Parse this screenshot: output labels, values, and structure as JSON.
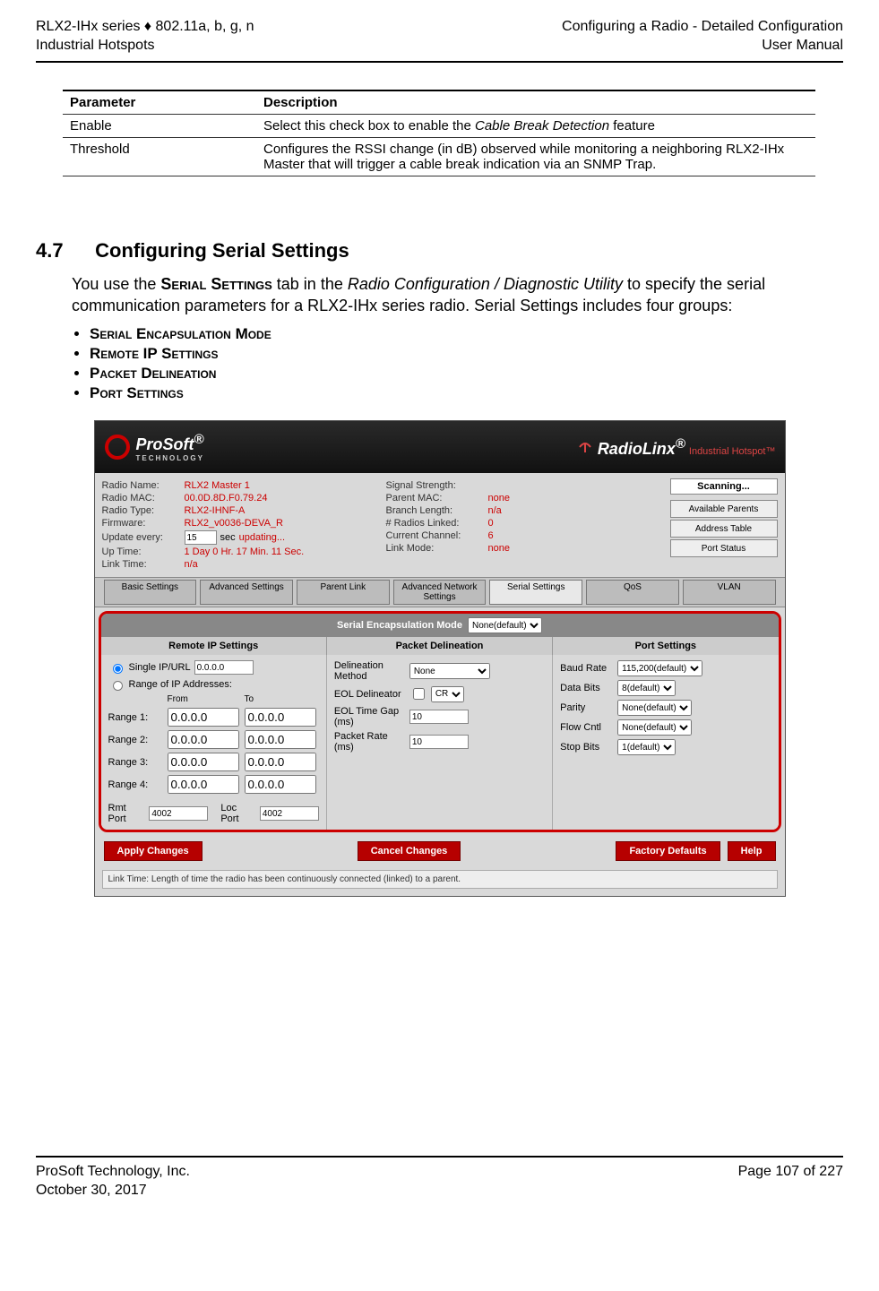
{
  "header": {
    "left1": "RLX2-IHx series ♦ 802.11a, b, g, n",
    "left2": "Industrial Hotspots",
    "right1": "Configuring a Radio - Detailed Configuration",
    "right2": "User Manual"
  },
  "param_table": {
    "headers": [
      "Parameter",
      "Description"
    ],
    "rows": [
      [
        "Enable",
        "Select this check box to enable the Cable Break Detection feature"
      ],
      [
        "Threshold",
        "Configures the RSSI change (in dB) observed while monitoring a neighboring RLX2-IHx Master that will trigger a cable break indication via an SNMP Trap."
      ]
    ],
    "italic_phrase": "Cable Break Detection"
  },
  "section": {
    "number": "4.7",
    "title": "Configuring Serial Settings",
    "intro_pre": "You use the ",
    "intro_sc1": "Serial Settings",
    "intro_mid": " tab in the ",
    "intro_italic": "Radio Configuration / Diagnostic Utility",
    "intro_post": " to specify the serial communication parameters for a RLX2-IHx series radio. Serial Settings includes four groups:",
    "bullets": [
      "Serial Encapsulation Mode",
      "Remote IP Settings",
      "Packet Delineation",
      "Port Settings"
    ]
  },
  "app": {
    "prosoft": {
      "name": "ProSoft",
      "sub": "TECHNOLOGY"
    },
    "radiolinx": {
      "name": "RadioLinx",
      "tag": "Industrial Hotspot™"
    },
    "info_left": [
      {
        "label": "Radio Name:",
        "value": "RLX2 Master 1"
      },
      {
        "label": "Radio MAC:",
        "value": "00.0D.8D.F0.79.24"
      },
      {
        "label": "Radio Type:",
        "value": "RLX2-IHNF-A"
      },
      {
        "label": "Firmware:",
        "value": "RLX2_v0036-DEVA_R"
      }
    ],
    "update_every": {
      "label": "Update every:",
      "value": "15",
      "unit": "sec",
      "status": "updating..."
    },
    "info_left2": [
      {
        "label": "Up Time:",
        "value": "1 Day 0 Hr. 17 Min. 11 Sec."
      },
      {
        "label": "Link Time:",
        "value": "n/a"
      }
    ],
    "info_mid": [
      {
        "label": "Signal Strength:"
      },
      {
        "label": "Parent MAC:",
        "value": "none"
      },
      {
        "label": "Branch Length:",
        "value": "n/a"
      },
      {
        "label": "# Radios Linked:",
        "value": "0"
      },
      {
        "label": "Current Channel:",
        "value": "6"
      },
      {
        "label": "Link Mode:",
        "value": "none"
      }
    ],
    "scanning": "Scanning...",
    "side_buttons": [
      "Available Parents",
      "Address Table",
      "Port Status"
    ],
    "tabs": [
      "Basic Settings",
      "Advanced Settings",
      "Parent Link",
      "Advanced Network Settings",
      "Serial Settings",
      "QoS",
      "VLAN"
    ],
    "enc_label": "Serial Encapsulation Mode",
    "enc_value": "None(default)",
    "col_heads": [
      "Remote IP Settings",
      "Packet Delineation",
      "Port Settings"
    ],
    "remote": {
      "single_label": "Single IP/URL",
      "single_value": "0.0.0.0",
      "range_label": "Range of IP Addresses:",
      "from": "From",
      "to": "To",
      "ranges": [
        {
          "name": "Range 1:",
          "from": "0.0.0.0",
          "to": "0.0.0.0"
        },
        {
          "name": "Range 2:",
          "from": "0.0.0.0",
          "to": "0.0.0.0"
        },
        {
          "name": "Range 3:",
          "from": "0.0.0.0",
          "to": "0.0.0.0"
        },
        {
          "name": "Range 4:",
          "from": "0.0.0.0",
          "to": "0.0.0.0"
        }
      ],
      "rmt_port_label": "Rmt Port",
      "rmt_port": "4002",
      "loc_port_label": "Loc Port",
      "loc_port": "4002"
    },
    "delineation": {
      "rows": [
        {
          "label": "Delineation Method",
          "type": "select",
          "value": "None"
        },
        {
          "label": "EOL Delineator",
          "type": "checkbox_select",
          "value": "CR"
        },
        {
          "label": "EOL Time Gap (ms)",
          "type": "text",
          "value": "10"
        },
        {
          "label": "Packet Rate (ms)",
          "type": "text",
          "value": "10"
        }
      ]
    },
    "port": {
      "rows": [
        {
          "label": "Baud Rate",
          "value": "115,200(default)"
        },
        {
          "label": "Data Bits",
          "value": "8(default)"
        },
        {
          "label": "Parity",
          "value": "None(default)"
        },
        {
          "label": "Flow Cntl",
          "value": "None(default)"
        },
        {
          "label": "Stop Bits",
          "value": "1(default)"
        }
      ]
    },
    "buttons": [
      "Apply Changes",
      "Cancel Changes",
      "Factory Defaults",
      "Help"
    ],
    "hint": "Link Time: Length of time the radio has been continuously connected (linked) to a parent."
  },
  "footer": {
    "left1": "ProSoft Technology, Inc.",
    "left2": "October 30, 2017",
    "right1": "Page 107 of 227"
  }
}
